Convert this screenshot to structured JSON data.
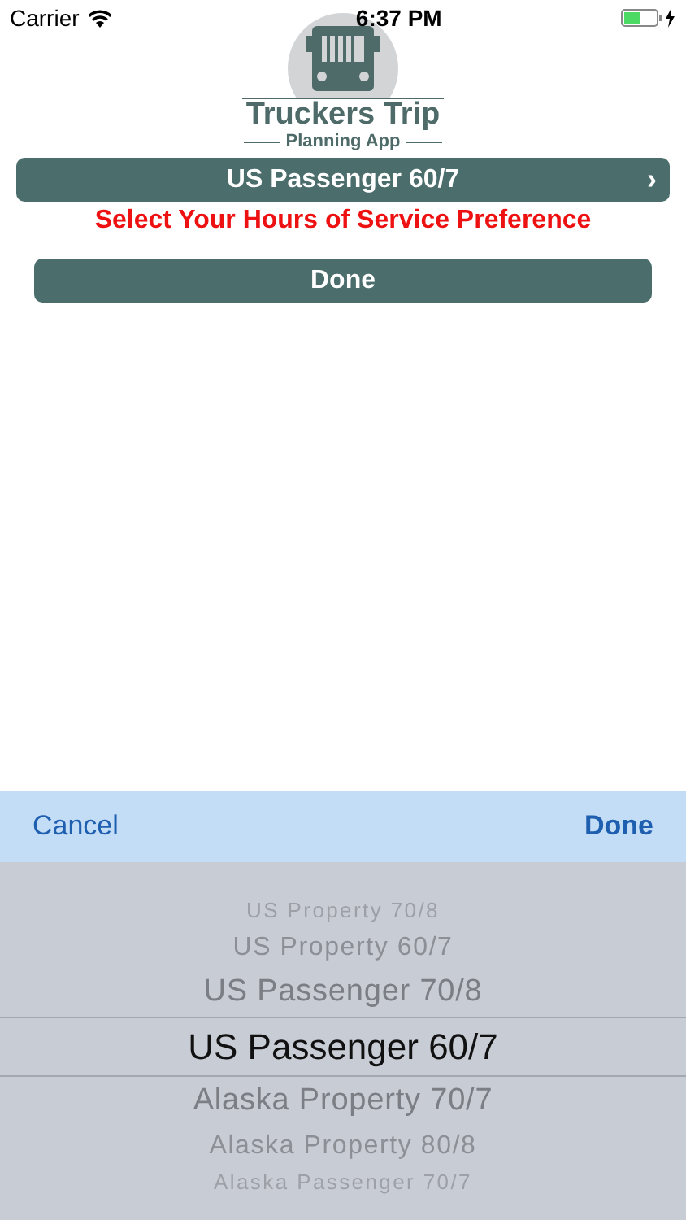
{
  "status_bar": {
    "carrier": "Carrier",
    "time": "6:37 PM"
  },
  "logo": {
    "title": "Truckers Trip",
    "subtitle": "Planning App"
  },
  "selector": {
    "value": "US Passenger 60/7",
    "chevron": "›"
  },
  "instruction": "Select Your Hours of Service Preference",
  "done_button": "Done",
  "toolbar": {
    "cancel": "Cancel",
    "done": "Done"
  },
  "picker": [
    {
      "label": "US Property 70/8",
      "selected": false
    },
    {
      "label": "US Property 60/7",
      "selected": false
    },
    {
      "label": "US Passenger 70/8",
      "selected": false
    },
    {
      "label": "US Passenger 60/7",
      "selected": true
    },
    {
      "label": "Alaska Property 70/7",
      "selected": false
    },
    {
      "label": "Alaska Property 80/8",
      "selected": false
    },
    {
      "label": "Alaska Passenger 70/7",
      "selected": false
    }
  ]
}
